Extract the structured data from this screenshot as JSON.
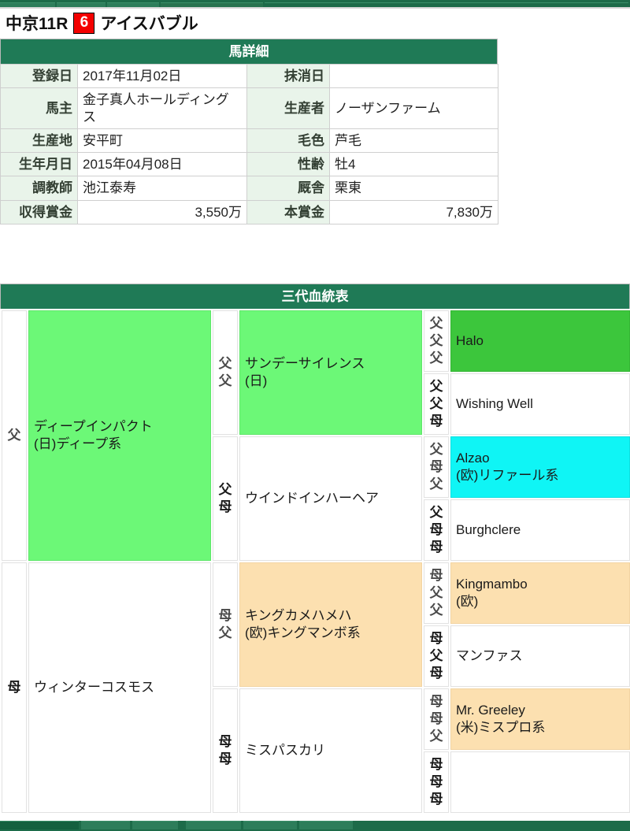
{
  "race_header": {
    "course_and_race": "中京11R",
    "frame_number": "6",
    "horse_name": "アイスバブル"
  },
  "detail_section": {
    "title": "馬詳細",
    "rows": [
      {
        "label_left": "登録日",
        "value_left": "2017年11月02日",
        "value_left_align": "left",
        "label_right": "抹消日",
        "value_right": "",
        "value_right_align": "left"
      },
      {
        "label_left": "馬主",
        "value_left": "金子真人ホールディングス",
        "value_left_align": "left",
        "label_right": "生産者",
        "value_right": "ノーザンファーム",
        "value_right_align": "left"
      },
      {
        "label_left": "生産地",
        "value_left": "安平町",
        "value_left_align": "left",
        "label_right": "毛色",
        "value_right": "芦毛",
        "value_right_align": "left"
      },
      {
        "label_left": "生年月日",
        "value_left": "2015年04月08日",
        "value_left_align": "left",
        "label_right": "性齢",
        "value_right": "牡4",
        "value_right_align": "left"
      },
      {
        "label_left": "調教師",
        "value_left": "池江泰寿",
        "value_left_align": "left",
        "label_right": "厩舎",
        "value_right": "栗東",
        "value_right_align": "left"
      },
      {
        "label_left": "収得賞金",
        "value_left": "3,550万",
        "value_left_align": "right",
        "label_right": "本賞金",
        "value_right": "7,830万",
        "value_right_align": "right"
      }
    ]
  },
  "pedigree_section": {
    "title": "三代血統表",
    "generation_marks": {
      "sire": "父",
      "dam": "母"
    },
    "gen1": [
      {
        "marks": [
          "父"
        ],
        "mark_tone": "dark",
        "name": "ディープインパクト",
        "sub": "(日)ディープ系",
        "color": "green-lt"
      },
      {
        "marks": [
          "母"
        ],
        "mark_tone": "light",
        "name": "ウィンターコスモス",
        "sub": "",
        "color": "plain"
      }
    ],
    "gen2": [
      {
        "marks": [
          "父",
          "父"
        ],
        "mark_tone": "dark",
        "name": "サンデーサイレンス",
        "sub": "(日)",
        "color": "green-lt"
      },
      {
        "marks": [
          "父",
          "母"
        ],
        "mark_tone": "light",
        "name": "ウインドインハーヘア",
        "sub": "",
        "color": "plain"
      },
      {
        "marks": [
          "母",
          "父"
        ],
        "mark_tone": "dark",
        "name": "キングカメハメハ",
        "sub": "(欧)キングマンボ系",
        "color": "orange"
      },
      {
        "marks": [
          "母",
          "母"
        ],
        "mark_tone": "light",
        "name": "ミスパスカリ",
        "sub": "",
        "color": "plain"
      }
    ],
    "gen3": [
      {
        "marks": [
          "父",
          "父",
          "父"
        ],
        "mark_tone": "dark",
        "name": "Halo",
        "sub": "",
        "color": "green-dk"
      },
      {
        "marks": [
          "父",
          "父",
          "母"
        ],
        "mark_tone": "light",
        "name": "Wishing Well",
        "sub": "",
        "color": "plain"
      },
      {
        "marks": [
          "父",
          "母",
          "父"
        ],
        "mark_tone": "dark",
        "name": "Alzao",
        "sub": "(欧)リファール系",
        "color": "cyan"
      },
      {
        "marks": [
          "父",
          "母",
          "母"
        ],
        "mark_tone": "light",
        "name": "Burghclere",
        "sub": "",
        "color": "plain"
      },
      {
        "marks": [
          "母",
          "父",
          "父"
        ],
        "mark_tone": "dark",
        "name": "Kingmambo",
        "sub": "(欧)",
        "color": "orange"
      },
      {
        "marks": [
          "母",
          "父",
          "母"
        ],
        "mark_tone": "light",
        "name": "マンファス",
        "sub": "",
        "color": "plain"
      },
      {
        "marks": [
          "母",
          "母",
          "父"
        ],
        "mark_tone": "dark",
        "name": "Mr. Greeley",
        "sub": "(米)ミスプロ系",
        "color": "orange"
      },
      {
        "marks": [
          "母",
          "母",
          "母"
        ],
        "mark_tone": "light",
        "name": "",
        "sub": "",
        "color": "plain"
      }
    ]
  },
  "colors": {
    "header_green": "#1f7a56",
    "frame_red": "#f40000",
    "pedigree_green_light": "#6cf877",
    "pedigree_green_dark": "#3cc63c",
    "pedigree_cyan": "#0ff5f5",
    "pedigree_orange": "#fce0b0",
    "label_cell_bg": "#e9f4ea"
  }
}
